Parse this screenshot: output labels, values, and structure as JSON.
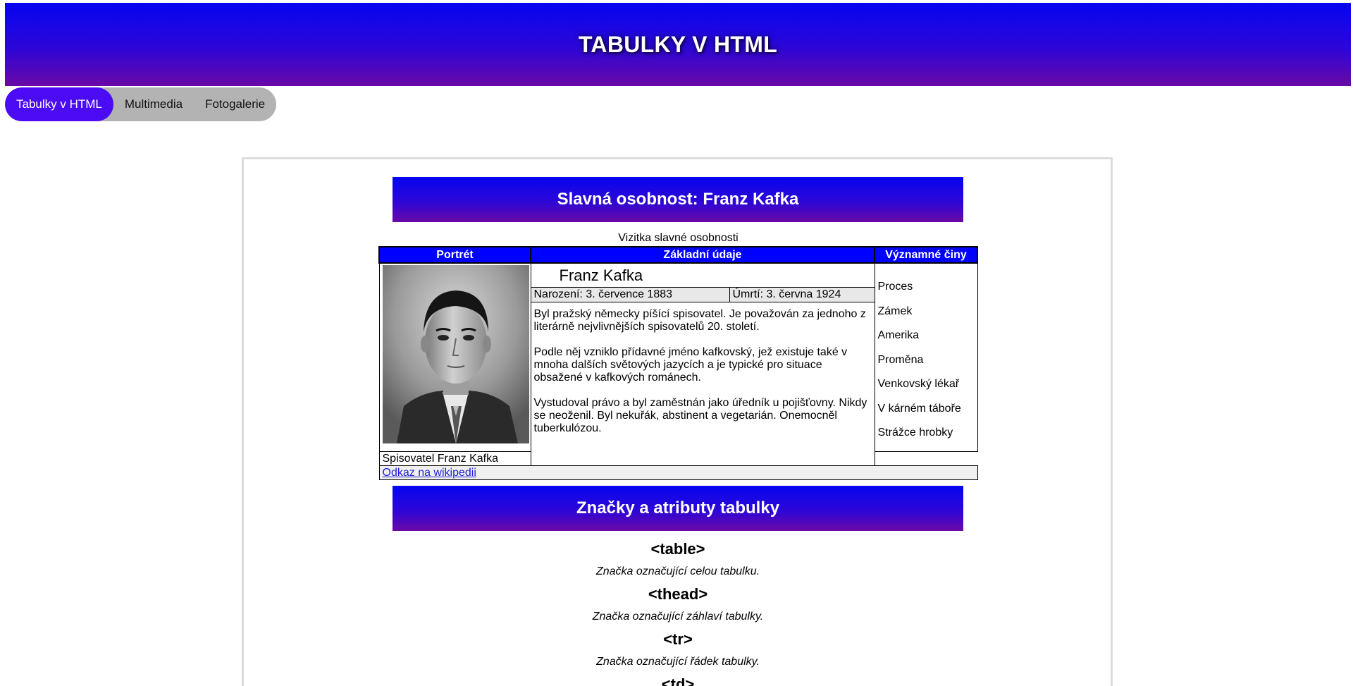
{
  "header": {
    "title": "TABULKY V HTML"
  },
  "nav": {
    "items": [
      {
        "label": "Tabulky v HTML",
        "active": true
      },
      {
        "label": "Multimedia",
        "active": false
      },
      {
        "label": "Fotogalerie",
        "active": false
      }
    ]
  },
  "sections": {
    "personality_title": "Slavná osobnost: Franz Kafka",
    "tags_title": "Značky a atributy tabulky"
  },
  "card": {
    "caption": "Vizitka slavné osobnosti",
    "headers": {
      "portrait": "Portrét",
      "basic": "Základní údaje",
      "works": "Významné činy"
    },
    "name": "Franz Kafka",
    "born": "Narození: 3. července 1883",
    "died": "Úmrtí: 3. června 1924",
    "bio": [
      "Byl pražský německy píšící spisovatel. Je považován za jednoho z literárně nejvlivnějších spisovatelů 20. století.",
      "Podle něj vzniklo přídavné jméno kafkovský, jež existuje také v mnoha dalších světových jazycích a je typické pro situace obsažené v kafkových románech.",
      "Vystudoval právo a byl zaměstnán jako úředník u pojišťovny. Nikdy se neoženil. Byl nekuřák, abstinent a vegetarián. Onemocněl tuberkulózou."
    ],
    "portrait_caption": "Spisovatel Franz Kafka",
    "works": [
      "Proces",
      "Zámek",
      "Amerika",
      "Proměna",
      "Venkovský lékař",
      "V kárném táboře",
      "Strážce hrobky"
    ],
    "link_text": "Odkaz na wikipedii"
  },
  "tags": [
    {
      "name": "<table>",
      "desc": "Značka označující celou tabulku."
    },
    {
      "name": "<thead>",
      "desc": "Značka označující záhlaví tabulky."
    },
    {
      "name": "<tr>",
      "desc": "Značka označující řádek tabulky."
    },
    {
      "name": "<td>",
      "desc": ""
    }
  ],
  "colors": {
    "banner_top": "#0505f2",
    "banner_bottom": "#6a08a6",
    "nav_active": "#4b0cf5",
    "table_header": "#0000ff"
  }
}
